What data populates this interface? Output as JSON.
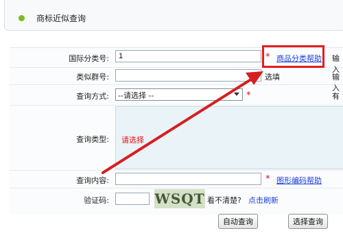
{
  "header": {
    "title": "商标近似查询"
  },
  "form": {
    "class_label": "国际分类号:",
    "class_value": "1",
    "class_help_link": "商品分类帮助",
    "class_hint": "输入",
    "group_label": "类似群号:",
    "group_value": "",
    "group_optional": "选填",
    "group_hint": "输入",
    "method_label": "查询方式:",
    "method_selected": "--请选择 --",
    "method_hint": "有",
    "type_label": "查询类型:",
    "type_prompt": "请选择",
    "content_label": "查询内容:",
    "content_value": "",
    "content_help_link": "图形编码帮助",
    "captcha_label": "验证码:",
    "captcha_value": "",
    "captcha_image_text": "WSQT",
    "captcha_unclear": "看不清楚?",
    "captcha_refresh": "点击刷新"
  },
  "buttons": {
    "auto_query": "自动查询",
    "select_query": "选择查询"
  },
  "colors": {
    "accent_dot": "#7dbb1e",
    "required_star": "#e01010",
    "link": "#1a3fd8",
    "annotation": "#e21d1d"
  }
}
